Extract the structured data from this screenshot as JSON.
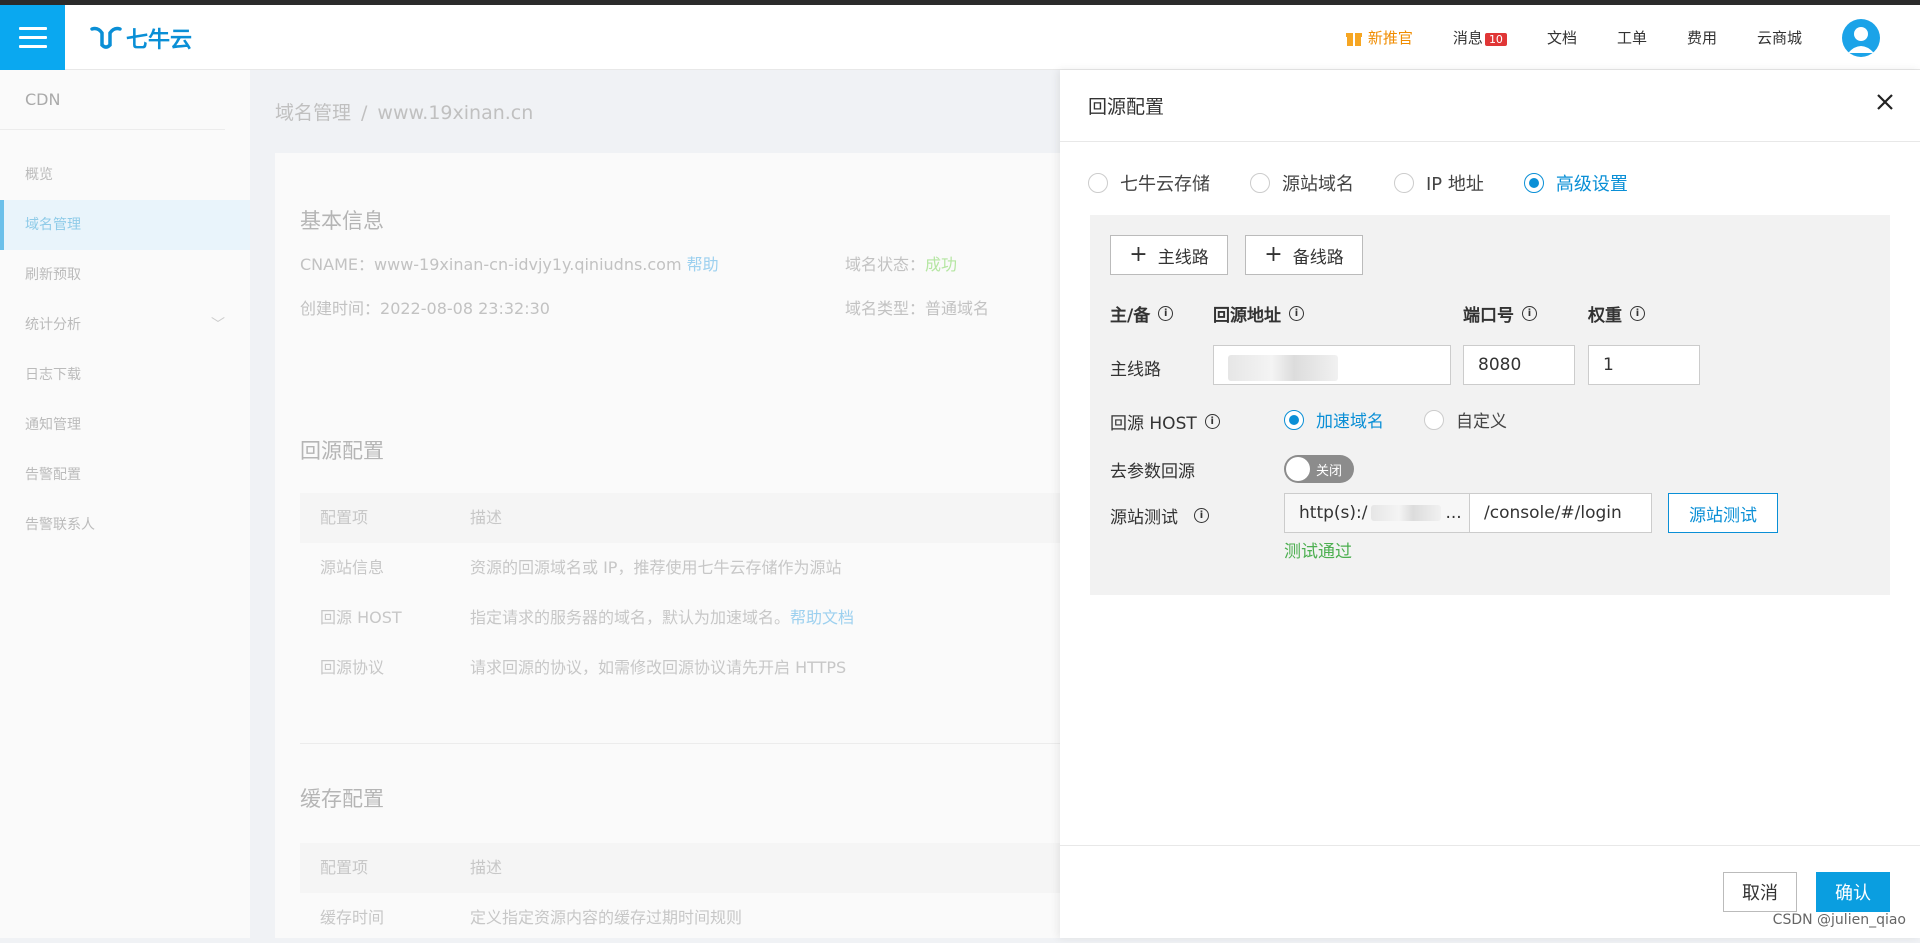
{
  "header": {
    "logo_text": "七牛云",
    "nav": {
      "promo": "新推官",
      "messages": "消息",
      "messages_count": "10",
      "docs": "文档",
      "tickets": "工单",
      "billing": "费用",
      "mall": "云商城"
    }
  },
  "sidebar": {
    "title": "CDN",
    "items": [
      {
        "label": "概览"
      },
      {
        "label": "域名管理"
      },
      {
        "label": "刷新预取"
      },
      {
        "label": "统计分析"
      },
      {
        "label": "日志下载"
      },
      {
        "label": "通知管理"
      },
      {
        "label": "告警配置"
      },
      {
        "label": "告警联系人"
      }
    ]
  },
  "main": {
    "breadcrumb": {
      "root": "域名管理",
      "sep": "/",
      "current": "www.19xinan.cn"
    },
    "basic": {
      "title": "基本信息",
      "cname_label": "CNAME：",
      "cname_value": "www-19xinan-cn-idvjy1y.qiniudns.com",
      "help": "帮助",
      "created_label": "创建时间：",
      "created_value": "2022-08-08 23:32:30",
      "status_label": "域名状态：",
      "status_value": "成功",
      "type_label": "域名类型：",
      "type_value": "普通域名"
    },
    "origin": {
      "title": "回源配置",
      "headers": [
        "配置项",
        "描述"
      ],
      "rows": [
        {
          "k": "源站信息",
          "v": "资源的回源域名或 IP，推荐使用七牛云存储作为源站"
        },
        {
          "k": "回源 HOST",
          "v": "指定请求的服务器的域名，默认为加速域名。",
          "link": "帮助文档"
        },
        {
          "k": "回源协议",
          "v": "请求回源的协议，如需修改回源协议请先开启 HTTPS"
        }
      ]
    },
    "cache": {
      "title": "缓存配置",
      "headers": [
        "配置项",
        "描述"
      ],
      "row_k": "缓存时间",
      "row_v": "定义指定资源内容的缓存过期时间规则"
    }
  },
  "drawer": {
    "title": "回源配置",
    "close": "X",
    "radios": [
      {
        "label": "七牛云存储",
        "selected": false
      },
      {
        "label": "源站域名",
        "selected": false
      },
      {
        "label": "IP 地址",
        "selected": false
      },
      {
        "label": "高级设置",
        "selected": true
      }
    ],
    "add_primary": "主线路",
    "add_backup": "备线路",
    "cols": {
      "type": "主/备",
      "addr": "回源地址",
      "port": "端口号",
      "weight": "权重"
    },
    "row": {
      "type": "主线路",
      "port": "8080",
      "weight": "1"
    },
    "host": {
      "label": "回源 HOST",
      "opt1": "加速域名",
      "opt2": "自定义",
      "selected": "加速域名"
    },
    "strip": {
      "label": "去参数回源",
      "state": "关闭"
    },
    "test": {
      "label": "源站测试",
      "prefix": "http(s):/",
      "ellipsis": "...",
      "path": "/console/#/login",
      "button": "源站测试",
      "result": "测试通过"
    },
    "footer": {
      "cancel": "取消",
      "ok": "确认"
    }
  },
  "watermark": "CSDN @julien_qiao",
  "colors": {
    "brand": "#0a8fd6",
    "promo": "#f08c00",
    "success": "#4caf50"
  }
}
